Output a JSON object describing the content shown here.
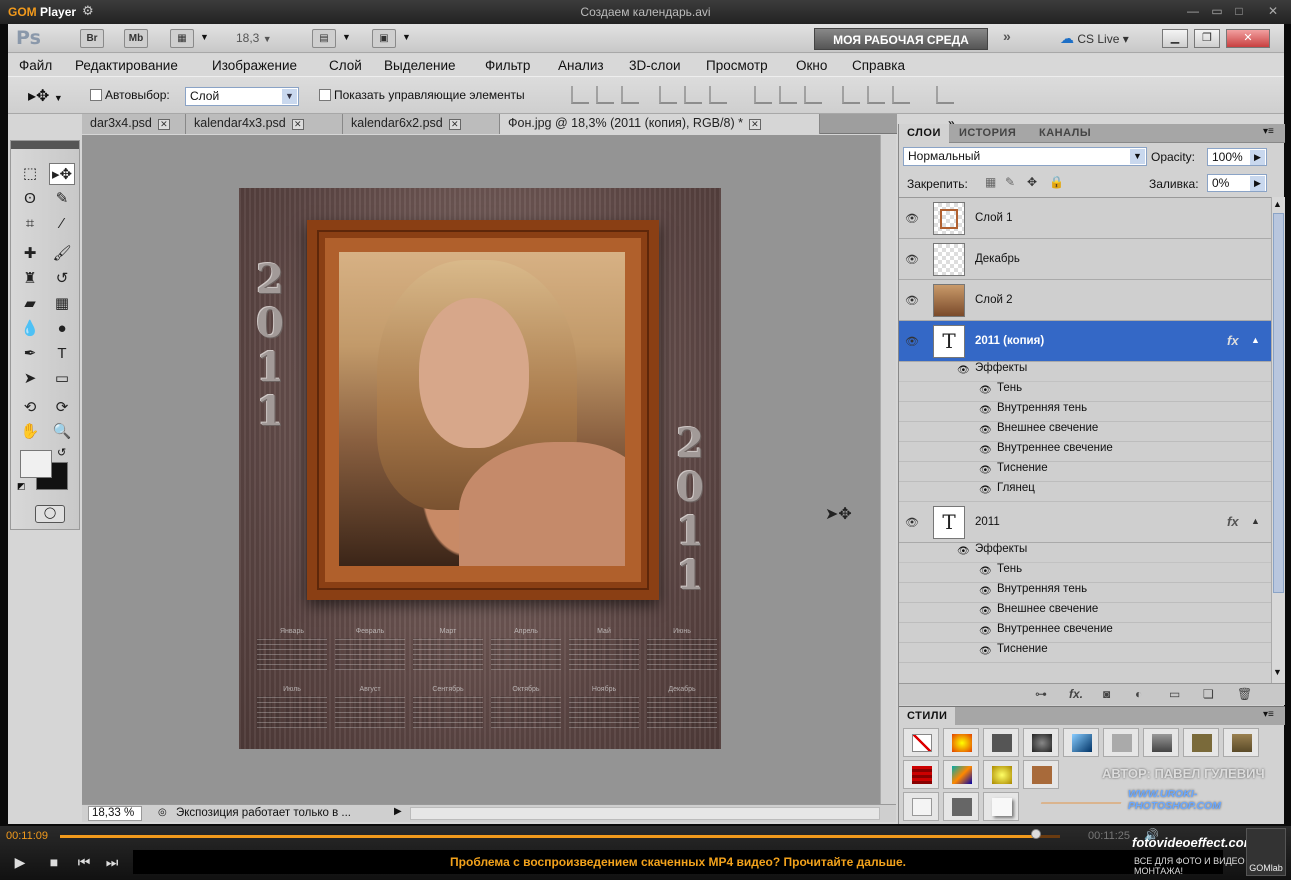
{
  "player": {
    "logo": "GOM",
    "logo_suffix": "Player",
    "file_title": "Создаем календарь.avi",
    "time_current": "00:11:09",
    "time_total": "00:11:25",
    "progress_percent": 97.6,
    "ticker": "Проблема с воспроизведением скаченных MP4 видео? Прочитайте дальше.",
    "brand": "fotovideoeffect.com",
    "brand_sub": "ВСЕ ДЛЯ ФОТО И ВИДЕО МОНТАЖА!",
    "gomlab": "GOMlab"
  },
  "appbar": {
    "ps": "Ps",
    "br": "Br",
    "mb": "Mb",
    "zoom": "18,3",
    "workspace": "МОЯ РАБОЧАЯ СРЕДА",
    "cs_live": "CS Live"
  },
  "menu": [
    "Файл",
    "Редактирование",
    "Изображение",
    "Слой",
    "Выделение",
    "Фильтр",
    "Анализ",
    "3D-слои",
    "Просмотр",
    "Окно",
    "Справка"
  ],
  "options": {
    "autoselect": "Автовыбор:",
    "autoselect_value": "Слой",
    "show_controls": "Показать управляющие элементы"
  },
  "tabs": [
    {
      "label": "dar3x4.psd"
    },
    {
      "label": "kalendar4x3.psd"
    },
    {
      "label": "kalendar6x2.psd"
    },
    {
      "label": "Фон.jpg @ 18,3% (2011 (копия), RGB/8) *"
    }
  ],
  "document": {
    "year_left": [
      "2",
      "0",
      "1",
      "1"
    ],
    "year_right": [
      "2",
      "0",
      "1",
      "1"
    ],
    "months": [
      "Январь",
      "Февраль",
      "Март",
      "Апрель",
      "Май",
      "Июнь",
      "Июль",
      "Август",
      "Сентябрь",
      "Октябрь",
      "Ноябрь",
      "Декабрь"
    ]
  },
  "status": {
    "zoom": "18,33 %",
    "text": "Экспозиция работает только в ..."
  },
  "layers_panel": {
    "tabs": [
      "СЛОИ",
      "ИСТОРИЯ",
      "КАНАЛЫ"
    ],
    "blend_mode": "Нормальный",
    "opacity_label": "Opacity:",
    "opacity": "100%",
    "lock_label": "Закрепить:",
    "fill_label": "Заливка:",
    "fill": "0%",
    "layers": [
      {
        "name": "Слой 1"
      },
      {
        "name": "Декабрь"
      },
      {
        "name": "Слой 2"
      },
      {
        "name": "2011 (копия)",
        "fx": "fx"
      },
      {
        "name": "2011",
        "fx": "fx"
      }
    ],
    "effects_label": "Эффекты",
    "effects_a": [
      "Тень",
      "Внутренняя тень",
      "Внешнее свечение",
      "Внутреннее свечение",
      "Тиснение",
      "Глянец"
    ],
    "effects_b": [
      "Тень",
      "Внутренняя тень",
      "Внешнее свечение",
      "Внутреннее свечение",
      "Тиснение"
    ]
  },
  "styles_panel": {
    "tab": "СТИЛИ"
  },
  "watermark": {
    "author": "АВТОР: ПАВЕЛ ГУЛЕВИЧ",
    "site": "WWW.UROKI-PHOTOSHOP.COM"
  }
}
